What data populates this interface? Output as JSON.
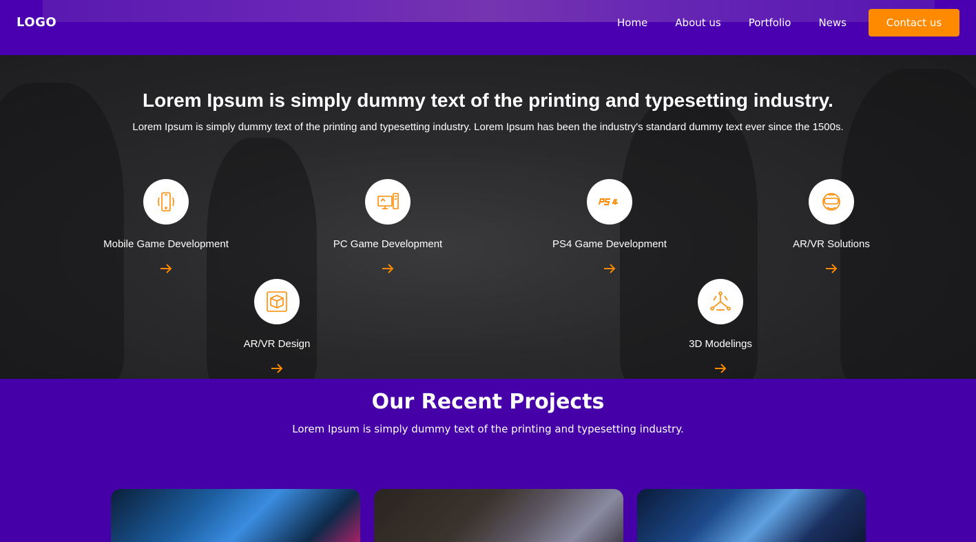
{
  "header": {
    "logo": "LOGO",
    "nav": [
      "Home",
      "About us",
      "Portfolio",
      "News"
    ],
    "contact_label": "Contact us"
  },
  "services": {
    "title": "Lorem Ipsum is simply dummy text of the printing and typesetting industry.",
    "subtitle": "Lorem Ipsum is simply dummy text of the printing and typesetting industry. Lorem Ipsum has been the industry's standard dummy text ever since the 1500s.",
    "items": [
      {
        "label": "Mobile Game Development",
        "icon": "mobile-icon"
      },
      {
        "label": "PC Game Development",
        "icon": "pc-icon"
      },
      {
        "label": "PS4 Game Development",
        "icon": "ps4-icon"
      },
      {
        "label": "AR/VR Solutions",
        "icon": "vr-headset-icon"
      },
      {
        "label": "AR/VR Design",
        "icon": "cube-icon"
      },
      {
        "label": "3D Modelings",
        "icon": "3d-model-icon"
      }
    ]
  },
  "projects": {
    "title": "Our Recent Projects",
    "subtitle": "Lorem Ipsum is simply dummy text of the printing and typesetting industry."
  },
  "colors": {
    "brand_purple": "#4500a8",
    "accent_orange": "#ff8a00"
  }
}
